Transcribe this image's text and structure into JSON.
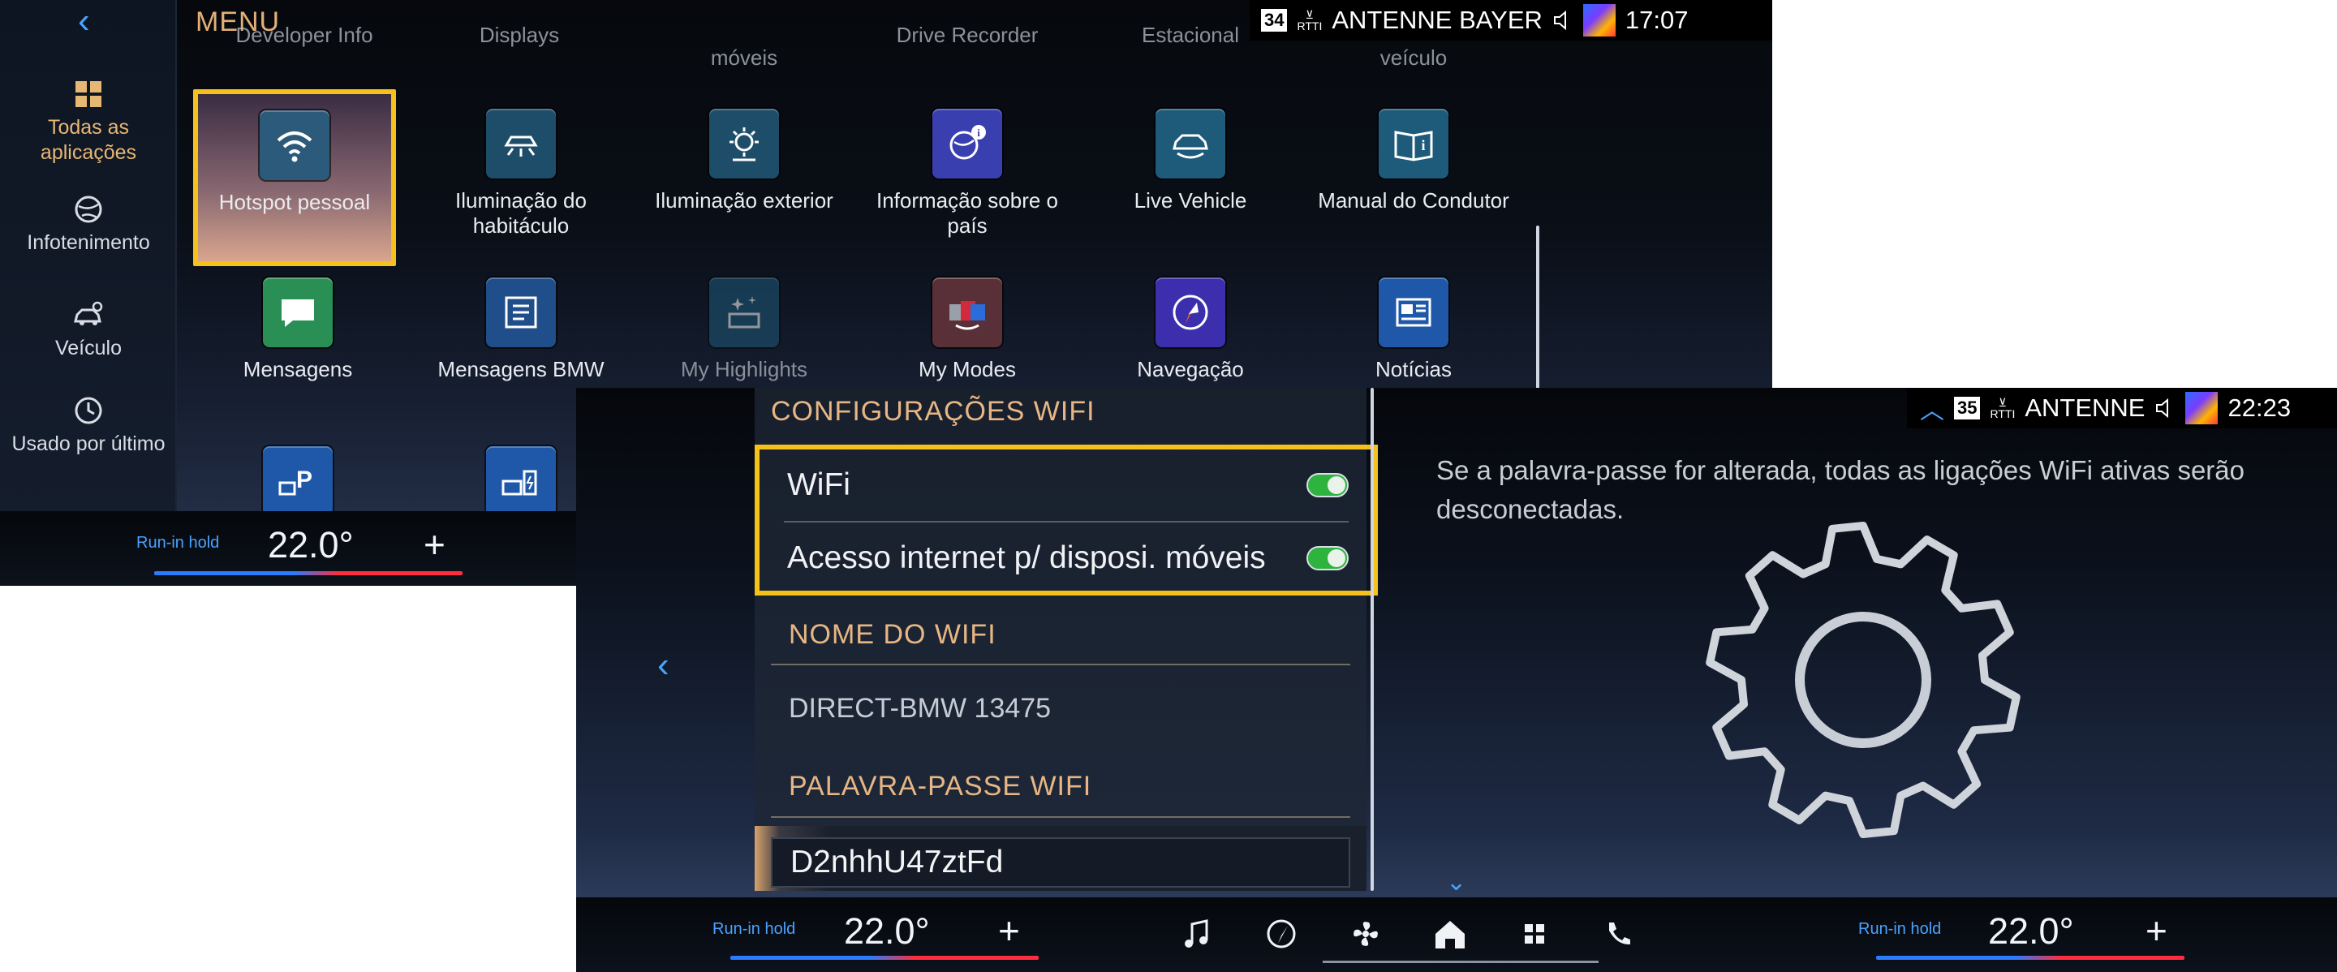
{
  "screen1": {
    "menu_title": "MENU",
    "back_label": "‹",
    "status": {
      "channel": "34",
      "rds": "RTTI",
      "station": "ANTENNE BAYER",
      "time": "17:07"
    },
    "sidebar": [
      {
        "label": "Todas as aplicações",
        "icon": "apps-grid-icon",
        "active": true
      },
      {
        "label": "Infotenimento",
        "icon": "globe-music-icon",
        "active": false
      },
      {
        "label": "Veículo",
        "icon": "car-settings-icon",
        "active": false
      },
      {
        "label": "Usado por último",
        "icon": "history-icon",
        "active": false
      }
    ],
    "ghost_row": [
      "Developer Info",
      "Displays",
      "móveis",
      "Drive Recorder",
      "Estacional",
      "veículo"
    ],
    "apps": [
      {
        "label": "Hotspot pessoal",
        "icon": "wifi-icon",
        "color": "#2b5a7a",
        "selected": true
      },
      {
        "label": "Iluminação do habitáculo",
        "icon": "cabin-light-icon",
        "color": "#1e4d6a"
      },
      {
        "label": "Iluminação exterior",
        "icon": "exterior-light-icon",
        "color": "#1e4d6a"
      },
      {
        "label": "Informação sobre o país",
        "icon": "country-info-icon",
        "color": "#3a3fb0"
      },
      {
        "label": "Live Vehicle",
        "icon": "live-vehicle-icon",
        "color": "#1e5a7a"
      },
      {
        "label": "Manual do Condutor",
        "icon": "manual-icon",
        "color": "#1e5a7a"
      },
      {
        "label": "Mensagens",
        "icon": "messages-icon",
        "color": "#2a8f55"
      },
      {
        "label": "Mensagens BMW",
        "icon": "bmw-messages-icon",
        "color": "#1f4e8a"
      },
      {
        "label": "My Highlights",
        "icon": "highlights-icon",
        "color": "#1e5a7a",
        "dim": true
      },
      {
        "label": "My Modes",
        "icon": "my-modes-icon",
        "color": "#6b2d3a"
      },
      {
        "label": "Navegação",
        "icon": "navigation-icon",
        "color": "#3b2fae"
      },
      {
        "label": "Notícias",
        "icon": "news-icon",
        "color": "#1f58a8"
      },
      {
        "label": "",
        "icon": "parking-icon",
        "color": "#1f58a8"
      },
      {
        "label": "",
        "icon": "charging-icon",
        "color": "#1f58a8"
      }
    ],
    "climate": {
      "run_hold": "Run-in hold",
      "temp": "22.0°",
      "plus": "+"
    }
  },
  "screen2": {
    "back_label": "‹",
    "header": "CONFIGURAÇÕES WIFI",
    "toggles": [
      {
        "label": "WiFi",
        "on": true
      },
      {
        "label": "Acesso internet p/ disposi. móveis",
        "on": true
      }
    ],
    "wifi_name_header": "NOME DO WIFI",
    "wifi_name": "DIRECT-BMW 13475",
    "password_header": "PALAVRA-PASSE WIFI",
    "password": "D2nhhU47ztFd",
    "info_text": "Se a palavra-passe for alterada, todas as ligações WiFi ativas serão desconectadas.",
    "status": {
      "channel": "35",
      "rds": "RTTI",
      "station": "ANTENNE",
      "time": "22:23"
    },
    "climate_left": {
      "run_hold": "Run-in hold",
      "temp": "22.0°",
      "plus": "+"
    },
    "climate_right": {
      "run_hold": "Run-in hold",
      "temp": "22.0°",
      "plus": "+"
    },
    "dock_icons": [
      "music-icon",
      "navigation-icon",
      "fan-icon",
      "home-icon",
      "apps-icon",
      "phone-icon"
    ]
  }
}
